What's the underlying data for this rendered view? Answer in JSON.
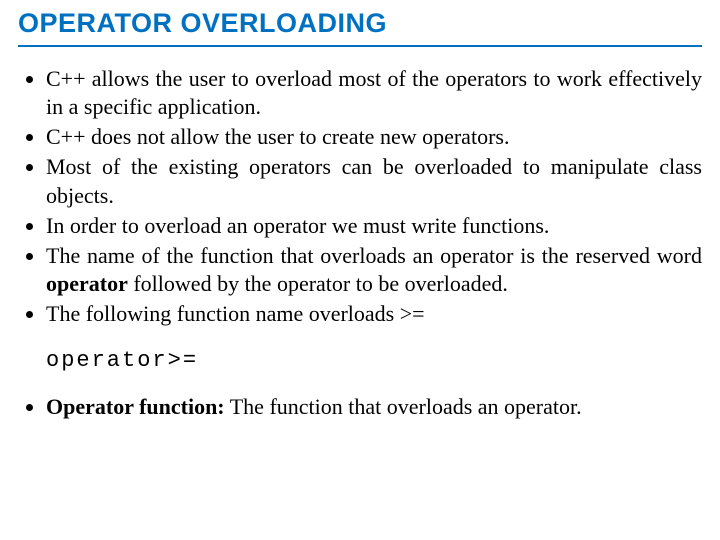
{
  "title": "OPERATOR OVERLOADING",
  "bullets1": [
    "C++ allows the user to overload most of the operators to work effectively in a specific application.",
    "C++ does not allow the user to create new operators.",
    "Most of the existing operators can be overloaded to manipulate class objects.",
    "In order to overload an operator we must write functions."
  ],
  "bullet_bold_lead": "The name of the function that overloads an operator is the reserved word ",
  "bullet_bold_word": "operator",
  "bullet_bold_tail": " followed by the operator to be overloaded.",
  "bullet_last": "The following function name overloads >=",
  "code": "operator>=",
  "bullet2_bold": "Operator function:",
  "bullet2_tail": " The function that overloads an operator."
}
